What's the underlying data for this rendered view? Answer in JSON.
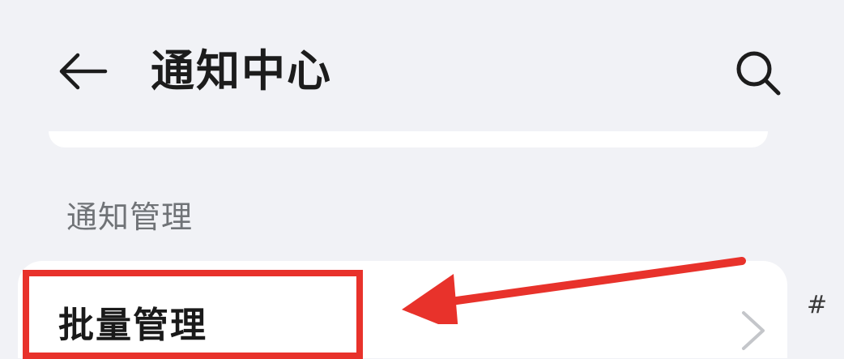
{
  "header": {
    "back_icon": "arrow-left-icon",
    "title": "通知中心",
    "search_icon": "search-icon"
  },
  "section": {
    "title": "通知管理"
  },
  "list": {
    "items": [
      {
        "label": "批量管理",
        "trailing_icon": "chevron-right-icon"
      }
    ]
  },
  "annotation": {
    "highlight_color": "#e8322b",
    "arrow_color": "#e8322b",
    "side_mark": "#"
  },
  "colors": {
    "background": "#f1f2f6",
    "card": "#ffffff",
    "title_text": "#1c1c1c",
    "section_text": "#707377"
  }
}
